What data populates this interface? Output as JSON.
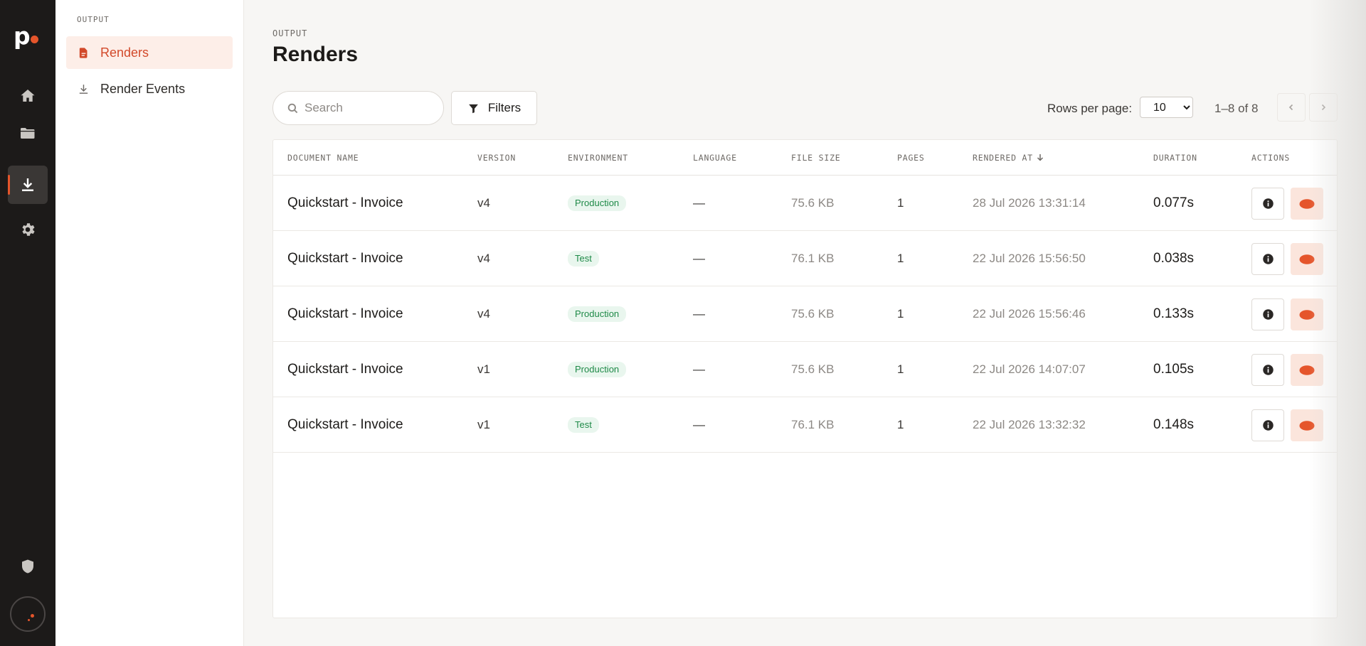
{
  "brand": {
    "logo_letter": "p"
  },
  "rail": {
    "items": [
      {
        "name": "home",
        "icon": "home-icon"
      },
      {
        "name": "documents",
        "icon": "folder-icon"
      },
      {
        "name": "output",
        "icon": "download-icon",
        "active": true
      },
      {
        "name": "settings",
        "icon": "gear-icon"
      }
    ],
    "bottom": [
      {
        "name": "security",
        "icon": "shield-icon"
      },
      {
        "name": "account",
        "icon": "avatar-icon"
      }
    ]
  },
  "subnav": {
    "title": "OUTPUT",
    "items": [
      {
        "label": "Renders",
        "icon": "document-icon",
        "active": true
      },
      {
        "label": "Render Events",
        "icon": "download-icon"
      }
    ]
  },
  "page": {
    "eyebrow": "OUTPUT",
    "title": "Renders"
  },
  "toolbar": {
    "search_placeholder": "Search",
    "filters_label": "Filters",
    "rows_per_page_label": "Rows per page:",
    "rows_per_page_options": [
      "10"
    ],
    "rows_per_page_value": "10",
    "range_text": "1–8 of 8"
  },
  "table": {
    "columns": [
      "DOCUMENT NAME",
      "VERSION",
      "ENVIRONMENT",
      "LANGUAGE",
      "FILE SIZE",
      "PAGES",
      "RENDERED AT",
      "DURATION",
      "ACTIONS"
    ],
    "sort": {
      "column": "RENDERED AT",
      "direction": "desc"
    },
    "rows": [
      {
        "name": "Quickstart - Invoice",
        "version": "v4",
        "environment": "Production",
        "language": "—",
        "file_size": "75.6 KB",
        "pages": "1",
        "rendered_at": "28 Jul 2026 13:31:14",
        "duration": "0.077s"
      },
      {
        "name": "Quickstart - Invoice",
        "version": "v4",
        "environment": "Test",
        "language": "—",
        "file_size": "76.1 KB",
        "pages": "1",
        "rendered_at": "22 Jul 2026 15:56:50",
        "duration": "0.038s"
      },
      {
        "name": "Quickstart - Invoice",
        "version": "v4",
        "environment": "Production",
        "language": "—",
        "file_size": "75.6 KB",
        "pages": "1",
        "rendered_at": "22 Jul 2026 15:56:46",
        "duration": "0.133s"
      },
      {
        "name": "Quickstart - Invoice",
        "version": "v1",
        "environment": "Production",
        "language": "—",
        "file_size": "75.6 KB",
        "pages": "1",
        "rendered_at": "22 Jul 2026 14:07:07",
        "duration": "0.105s"
      },
      {
        "name": "Quickstart - Invoice",
        "version": "v1",
        "environment": "Test",
        "language": "—",
        "file_size": "76.1 KB",
        "pages": "1",
        "rendered_at": "22 Jul 2026 13:32:32",
        "duration": "0.148s"
      }
    ],
    "row_actions": [
      {
        "name": "info",
        "icon": "info-icon"
      },
      {
        "name": "view",
        "icon": "eye-icon"
      }
    ]
  },
  "colors": {
    "accent": "#e5552b",
    "rail_bg": "#1c1a19",
    "active_nav_bg": "#fdeee8",
    "badge_green": "#1f8a48",
    "badge_green_bg": "#e9f6ee"
  }
}
